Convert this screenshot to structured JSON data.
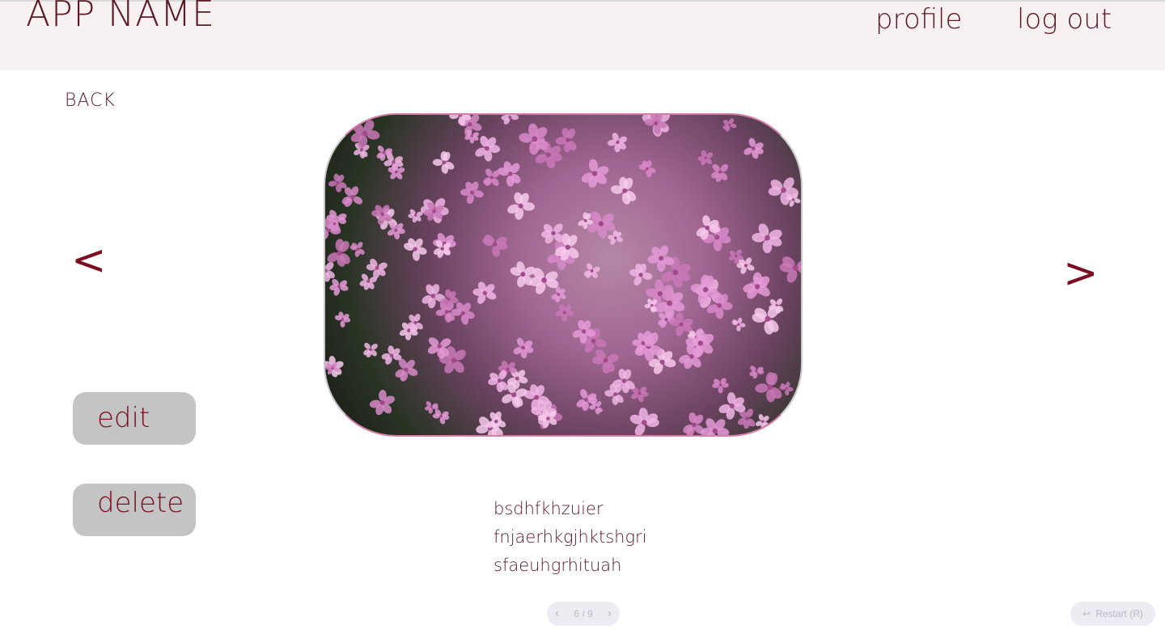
{
  "header": {
    "app_name": "APP NAME",
    "nav": {
      "profile": "profile",
      "logout": "log out"
    }
  },
  "back_label": "BACK",
  "navigation": {
    "prev_label": "<",
    "next_label": ">"
  },
  "actions": {
    "edit_label": "edit",
    "delete_label": "delete"
  },
  "description_lines": [
    "bsdhfkhzuier",
    "fnjaerhkgjhktshgri",
    "sfaeuhgrhituah"
  ],
  "pager": {
    "label": "6 / 9",
    "prev_icon": "chevron-left-icon",
    "next_icon": "chevron-right-icon"
  },
  "restart": {
    "label": "Restart (R)",
    "icon": "undo-icon"
  },
  "colors": {
    "header_bg": "#f8f1f1",
    "text_primary": "#5a1a26",
    "accent": "#7a0f22",
    "button_bg": "#c4c4c4"
  }
}
